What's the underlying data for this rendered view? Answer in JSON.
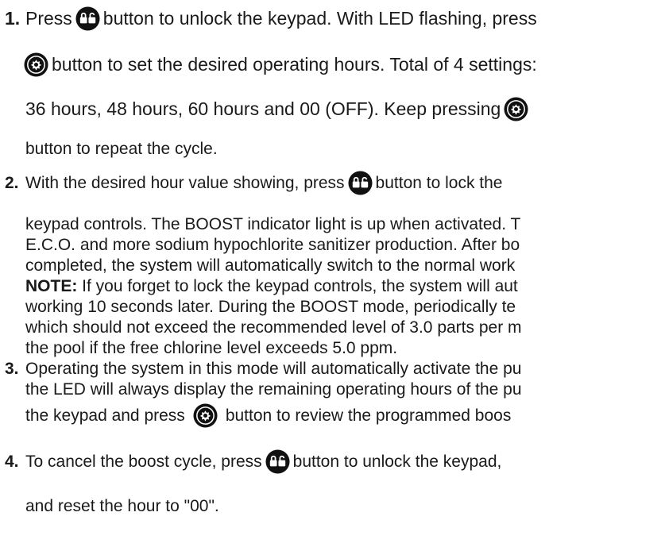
{
  "icons": {
    "lock": "lock-button-icon",
    "mode": "mode-button-icon"
  },
  "colors": {
    "text": "#1a1a1a",
    "background": "#ffffff"
  },
  "steps": [
    {
      "number": "1.",
      "lines": [
        {
          "a": "Press",
          "b": "button to unlock the keypad. With LED flashing, press"
        },
        {
          "b": "button to set the desired operating hours. Total of 4 settings:"
        },
        {
          "a": "36 hours, 48 hours, 60 hours and 00 (OFF). Keep pressing"
        },
        {
          "a": "button to repeat the cycle."
        }
      ]
    },
    {
      "number": "2.",
      "lines": [
        {
          "a": "With the desired hour value showing, press",
          "b": "button to lock the"
        },
        {
          "a": "keypad controls. The BOOST indicator light is up when activated. T"
        },
        {
          "a": "E.C.O. and more sodium hypochlorite sanitizer production. After bo"
        },
        {
          "a": "completed, the system will automatically switch to the normal work"
        },
        {
          "label": "NOTE:",
          "a": " If you forget to lock the keypad controls, the system will aut"
        },
        {
          "a": "working 10 seconds later. During the BOOST mode, periodically te"
        },
        {
          "a": "which should not exceed the recommended level of 3.0 parts per m"
        },
        {
          "a": "the pool if the free chlorine level exceeds 5.0 ppm."
        }
      ]
    },
    {
      "number": "3.",
      "lines": [
        {
          "a": "Operating the system in this mode will automatically activate the pu"
        },
        {
          "a": "the LED will always display the remaining operating hours of the pu"
        },
        {
          "a": "the keypad and press",
          "b": "button to review the programmed boos"
        }
      ]
    },
    {
      "number": "4.",
      "lines": [
        {
          "a": "To cancel the boost cycle, press",
          "b": "button to unlock the keypad,"
        },
        {
          "a": "and reset the hour to \"00\"."
        }
      ]
    }
  ]
}
